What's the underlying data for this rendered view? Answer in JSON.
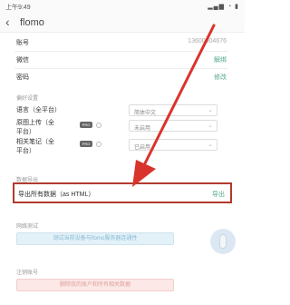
{
  "status_bar": {
    "time": "上午9:49",
    "icons": "▂▄▆ ◔ ▮"
  },
  "app_bar": {
    "title": "flomo"
  },
  "account": {
    "rows": [
      {
        "label": "账号",
        "value": "13600004676"
      },
      {
        "label": "微信",
        "value": "解绑"
      },
      {
        "label": "密码",
        "value": "修改"
      }
    ]
  },
  "prefs": {
    "title": "偏好设置",
    "language": {
      "label": "语言（全平台）",
      "value": "简体中文"
    },
    "image_upload": {
      "label_line1": "原图上传（全",
      "label_line2": "平台）",
      "badge": "PRO",
      "value": "未启用"
    },
    "related_notes": {
      "label_line1": "相关笔记（全",
      "label_line2": "平台）",
      "badge": "PRO",
      "value": "已启用"
    }
  },
  "data_export": {
    "title": "数据导出",
    "label": "导出所有数据（as HTML）",
    "action": "导出"
  },
  "network": {
    "title": "网络测试",
    "button": "测试当前设备与flomo服务器连通性"
  },
  "account_delete": {
    "title": "注销账号",
    "button": "删除我的账户和所有相关数据"
  },
  "colors": {
    "accent": "#55a88a",
    "highlight": "#b13a2f",
    "arrow": "#d8342c"
  }
}
